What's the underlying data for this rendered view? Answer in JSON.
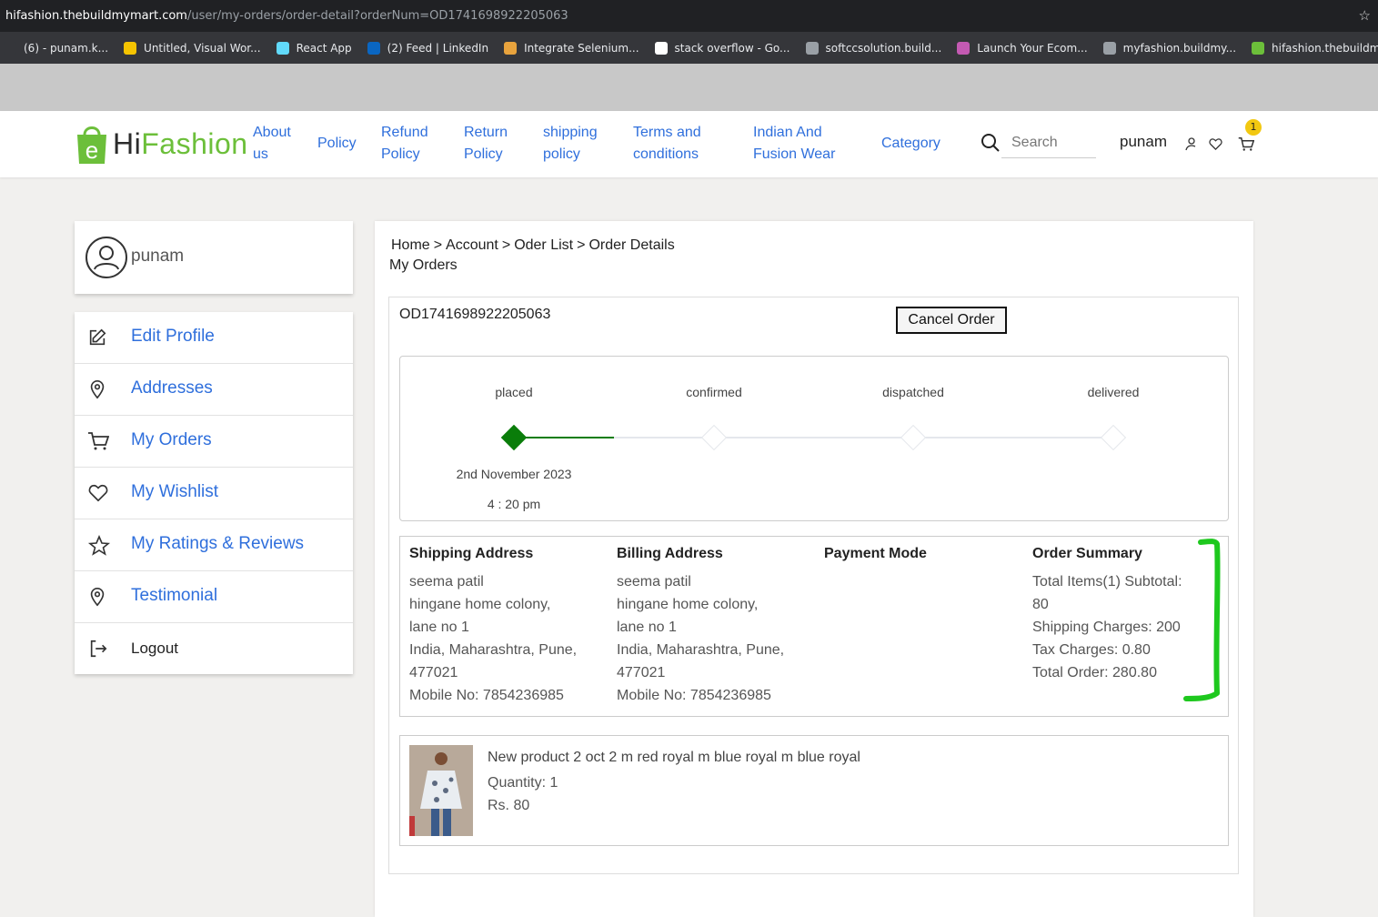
{
  "browser": {
    "url_host": "hifashion.thebuildmymart.com",
    "url_path": "/user/my-orders/order-detail?orderNum=OD1741698922205063",
    "bookmarks": [
      {
        "label": "(6) - punam.k...",
        "color": "#35363a"
      },
      {
        "label": "Untitled, Visual Wor...",
        "color": "#f5c400"
      },
      {
        "label": "React App",
        "color": "#61dafb"
      },
      {
        "label": "(2) Feed | LinkedIn",
        "color": "#0a66c2"
      },
      {
        "label": "Integrate Selenium...",
        "color": "#e8a33d"
      },
      {
        "label": "stack overflow - Go...",
        "color": "#ffffff"
      },
      {
        "label": "softccsolution.build...",
        "color": "#9aa0a6"
      },
      {
        "label": "Launch Your Ecom...",
        "color": "#c45ab3"
      },
      {
        "label": "myfashion.buildmy...",
        "color": "#9aa0a6"
      },
      {
        "label": "hifashion.thebuildm...",
        "color": "#6cbf3a"
      }
    ]
  },
  "header": {
    "logo_hi": "Hi",
    "logo_fashion": "Fashion",
    "nav": [
      {
        "line1": "About",
        "line2": "us"
      },
      {
        "line1": "Policy",
        "line2": ""
      },
      {
        "line1": "Refund",
        "line2": "Policy"
      },
      {
        "line1": "Return",
        "line2": "Policy"
      },
      {
        "line1": "shipping",
        "line2": "policy"
      },
      {
        "line1": "Terms and",
        "line2": "conditions"
      },
      {
        "line1": "Indian And",
        "line2": "Fusion Wear"
      },
      {
        "line1": "Category",
        "line2": ""
      }
    ],
    "search_placeholder": "Search",
    "username": "punam",
    "cart_count": "1"
  },
  "sidebar": {
    "profile_name": "punam",
    "items": [
      {
        "label": "Edit Profile",
        "icon": "edit-icon"
      },
      {
        "label": "Addresses",
        "icon": "location-pin-icon"
      },
      {
        "label": "My Orders",
        "icon": "cart-icon"
      },
      {
        "label": "My Wishlist",
        "icon": "heart-icon"
      },
      {
        "label": "My Ratings & Reviews",
        "icon": "star-icon"
      },
      {
        "label": "Testimonial",
        "icon": "location-pin-icon"
      },
      {
        "label": "Logout",
        "icon": "logout-icon"
      }
    ]
  },
  "breadcrumb": {
    "items": [
      "Home",
      "Account",
      "Oder List",
      "Order Details"
    ],
    "separator": ">"
  },
  "page_subtitle": "My Orders",
  "order": {
    "number": "OD1741698922205063",
    "cancel_label": "Cancel Order",
    "steps": [
      "placed",
      "confirmed",
      "dispatched",
      "delivered"
    ],
    "completed_steps": 1,
    "placed_date": "2nd November 2023",
    "placed_time": "4 : 20 pm",
    "active_color": "#0a7d0a",
    "inactive_color": "#e4e7ec"
  },
  "shipping": {
    "heading": "Shipping Address",
    "lines": [
      "seema patil",
      "hingane home colony,",
      "lane no 1",
      "India, Maharashtra, Pune,",
      "477021",
      "Mobile No: 7854236985"
    ]
  },
  "billing": {
    "heading": "Billing Address",
    "lines": [
      "seema patil",
      "hingane home colony,",
      "lane no 1",
      "India, Maharashtra, Pune,",
      "477021",
      "Mobile No: 7854236985"
    ]
  },
  "payment": {
    "heading": "Payment Mode"
  },
  "summary": {
    "heading": "Order Summary",
    "lines": [
      "Total Items(1) Subtotal:",
      "80",
      "Shipping Charges: 200",
      "Tax Charges: 0.80",
      "Total Order: 280.80"
    ]
  },
  "product": {
    "title": "New product 2 oct 2 m red royal m blue royal m blue royal",
    "quantity": "Quantity: 1",
    "price": "Rs. 80"
  }
}
